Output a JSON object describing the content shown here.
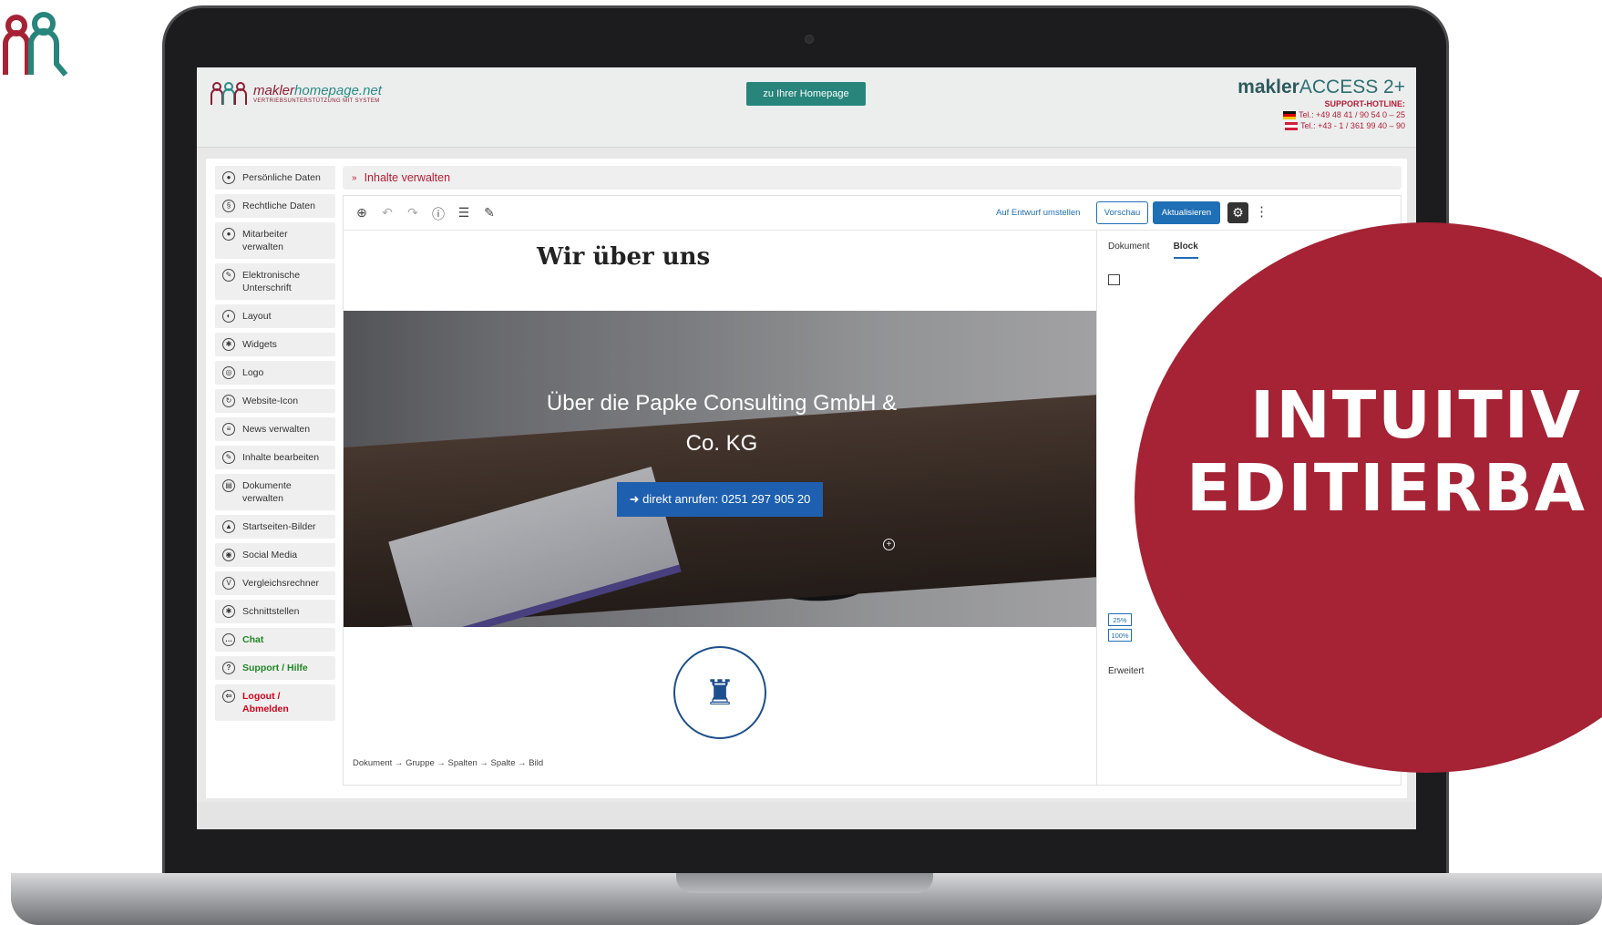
{
  "brand": {
    "name_a": "makler",
    "name_b": "homepage.net",
    "tagline": "VERTRIEBSUNTERSTÜTZUNG MIT SYSTEM"
  },
  "header": {
    "home_button": "zu Ihrer Homepage",
    "access_a": "makler",
    "access_b": "ACCESS 2+",
    "hotline": "SUPPORT-HOTLINE:",
    "tel_de": "Tel.: +49 48 41 / 90 54 0 – 25",
    "tel_at": "Tel.: +43 - 1 / 361 99 40 – 90"
  },
  "sidebar": {
    "items": [
      {
        "label": "Persönliche Daten",
        "icon": "person-icon"
      },
      {
        "label": "Rechtliche Daten",
        "icon": "paragraph-icon"
      },
      {
        "label": "Mitarbeiter verwalten",
        "icon": "users-icon"
      },
      {
        "label": "Elektronische Unterschrift",
        "icon": "signature-icon"
      },
      {
        "label": "Layout",
        "icon": "contrast-icon"
      },
      {
        "label": "Widgets",
        "icon": "widgets-icon"
      },
      {
        "label": "Logo",
        "icon": "logo-icon"
      },
      {
        "label": "Website-Icon",
        "icon": "website-icon"
      },
      {
        "label": "News verwalten",
        "icon": "news-icon"
      },
      {
        "label": "Inhalte bearbeiten",
        "icon": "edit-icon"
      },
      {
        "label": "Dokumente verwalten",
        "icon": "document-icon"
      },
      {
        "label": "Startseiten-Bilder",
        "icon": "image-icon"
      },
      {
        "label": "Social Media",
        "icon": "social-icon"
      },
      {
        "label": "Vergleichsrechner",
        "icon": "calculator-icon"
      },
      {
        "label": "Schnittstellen",
        "icon": "interface-icon"
      },
      {
        "label": "Chat",
        "icon": "chat-icon"
      },
      {
        "label": "Support / Hilfe",
        "icon": "help-icon"
      },
      {
        "label": "Logout / Abmelden",
        "icon": "logout-icon"
      }
    ]
  },
  "breadcrumb": {
    "arrow": "»",
    "label": "Inhalte verwalten"
  },
  "toolbar": {
    "draft": "Auf Entwurf umstellen",
    "preview": "Vorschau",
    "update": "Aktualisieren"
  },
  "page": {
    "title": "Wir über uns",
    "hero_text": "Über die Papke Consulting GmbH & Co. KG",
    "cta": "➜ direkt anrufen: 0251 297 905 20"
  },
  "footer_breadcrumb": "Dokument → Gruppe → Spalten → Spalte → Bild",
  "panel": {
    "tab_document": "Dokument",
    "tab_block": "Block",
    "pct_a": "25%",
    "pct_b": "100%",
    "advanced": "Erweitert"
  },
  "badge": {
    "line1": "INTUITIV",
    "line2": "EDITIERBA"
  },
  "colors": {
    "accent_teal": "#27857c",
    "accent_red": "#a52334",
    "link_blue": "#1e6fb5"
  }
}
